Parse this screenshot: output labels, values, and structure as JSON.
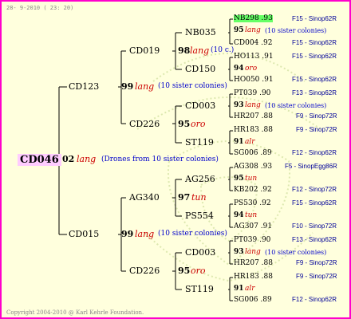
{
  "date_stamp": "28- 9-2010 ( 23: 20)",
  "copyright": "Copyright 2004-2010 @ Karl Kehrle Foundation.",
  "colors": {
    "border": "#ff00cc",
    "background": "#ffffdd",
    "queen_line": "#cc0000",
    "location": "#000099",
    "highlight": "#66ff66"
  },
  "root": {
    "id": "CD046",
    "year": "02",
    "line": "lang",
    "note": "(Drones from 10 sister colonies)"
  },
  "g1": [
    {
      "id": "CD123",
      "year": "99",
      "line": "lang",
      "note": "(10 sister colonies)"
    },
    {
      "id": "CD015",
      "year": "99",
      "line": "lang",
      "note": "(10 sister colonies)"
    }
  ],
  "g2": [
    {
      "id": "CD019",
      "year": "98",
      "line": "lang",
      "note": "(10 c.)"
    },
    {
      "id": "CD226",
      "year": "95",
      "line": "oro",
      "note": ""
    },
    {
      "id": "AG340",
      "year": "97",
      "line": "tun",
      "note": ""
    },
    {
      "id": "CD226",
      "year": "95",
      "line": "oro",
      "note": ""
    }
  ],
  "g3": [
    "NB035",
    "CD150",
    "CD003",
    "ST119",
    "AG256",
    "PS554",
    "CD003",
    "ST119"
  ],
  "g4": [
    {
      "top": "NB298 .93",
      "top_loc": "F15 - Sinop62R",
      "mid_year": "95",
      "mid_line": "lang",
      "mid_note": "(10 sister colonies)",
      "bot": "CD004 .92",
      "bot_loc": "F15 - Sinop62R"
    },
    {
      "top": "HO113 .91",
      "top_loc": "F15 - Sinop62R",
      "mid_year": "94",
      "mid_line": "oro",
      "mid_note": "",
      "bot": "HO050 .91",
      "bot_loc": "F15 - Sinop62R"
    },
    {
      "top": "PT039 .90",
      "top_loc": "F13 - Sinop62R",
      "mid_year": "93",
      "mid_line": "lang",
      "mid_note": "(10 sister colonies)",
      "bot": "HR207 .88",
      "bot_loc": "F9 - Sinop72R"
    },
    {
      "top": "HR183 .88",
      "top_loc": "F9 - Sinop72R",
      "mid_year": "91",
      "mid_line": "alr",
      "mid_note": "",
      "bot": "SG006 .89",
      "bot_loc": "F12 - Sinop62R"
    },
    {
      "top": "AG308 .93",
      "top_loc": "F5 - SinopEgg86R",
      "mid_year": "95",
      "mid_line": "tun",
      "mid_note": "",
      "bot": "KB202 .92",
      "bot_loc": "F12 - Sinop72R"
    },
    {
      "top": "PS530 .92",
      "top_loc": "F15 - Sinop62R",
      "mid_year": "94",
      "mid_line": "tun",
      "mid_note": "",
      "bot": "AG307 .91",
      "bot_loc": "F10 - Sinop72R"
    },
    {
      "top": "PT039 .90",
      "top_loc": "F13 - Sinop62R",
      "mid_year": "93",
      "mid_line": "lang",
      "mid_note": "(10 sister colonies)",
      "bot": "HR207 .88",
      "bot_loc": "F9 - Sinop72R"
    },
    {
      "top": "HR183 .88",
      "top_loc": "F9 - Sinop72R",
      "mid_year": "91",
      "mid_line": "alr",
      "mid_note": "",
      "bot": "SG006 .89",
      "bot_loc": "F12 - Sinop62R"
    }
  ]
}
